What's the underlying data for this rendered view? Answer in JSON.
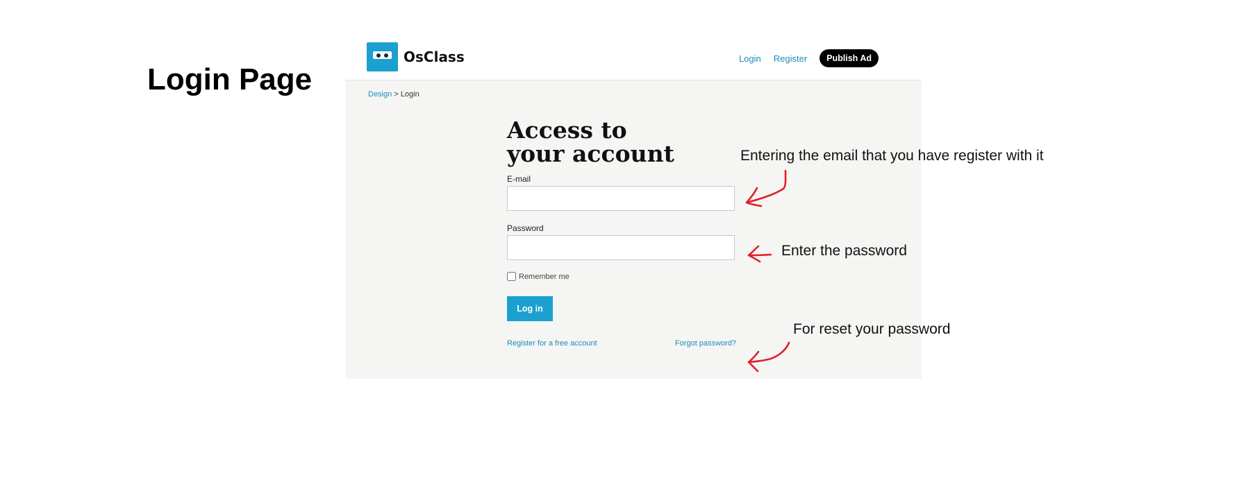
{
  "page": {
    "heading": "Login Page"
  },
  "header": {
    "logo_text": "OsClass",
    "nav": {
      "login": "Login",
      "register": "Register",
      "publish": "Publish Ad"
    }
  },
  "breadcrumb": {
    "parent": "Design",
    "separator": ">",
    "current": "Login"
  },
  "form": {
    "title": "Access to your account",
    "email_label": "E-mail",
    "email_value": "",
    "password_label": "Password",
    "password_value": "",
    "remember_label": "Remember me",
    "remember_checked": false,
    "submit_label": "Log in",
    "register_link": "Register for a free account",
    "forgot_link": "Forgot password?"
  },
  "annotations": {
    "email": "Entering the email that you have register with it",
    "password": "Enter the password",
    "reset": "For reset your password"
  },
  "colors": {
    "accent": "#1ba0cf",
    "link": "#1a8bbf",
    "content_bg": "#f5f5f3",
    "annotation_arrow": "#e0202a"
  }
}
